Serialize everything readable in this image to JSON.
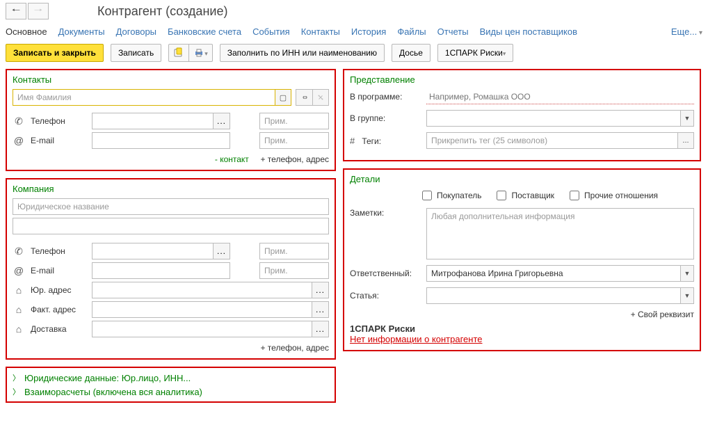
{
  "header": {
    "title": "Контрагент (создание)"
  },
  "tabs": {
    "main": "Основное",
    "docs": "Документы",
    "contracts": "Договоры",
    "bank": "Банковские счета",
    "events": "События",
    "contacts": "Контакты",
    "history": "История",
    "files": "Файлы",
    "reports": "Отчеты",
    "pricetypes": "Виды цен поставщиков",
    "more": "Еще..."
  },
  "toolbar": {
    "save_close": "Записать и закрыть",
    "save": "Записать",
    "fill_inn": "Заполнить по ИНН или наименованию",
    "dossier": "Досье",
    "spark": "1СПАРК Риски"
  },
  "contacts": {
    "title": "Контакты",
    "name_ph": "Имя Фамилия",
    "phone_label": "Телефон",
    "email_label": "E-mail",
    "note_ph": "Прим.",
    "minus_contact": "- контакт",
    "plus_phone": "+ телефон, адрес"
  },
  "company": {
    "title": "Компания",
    "legal_ph": "Юридическое название",
    "phone_label": "Телефон",
    "email_label": "E-mail",
    "legal_addr": "Юр. адрес",
    "actual_addr": "Факт. адрес",
    "delivery": "Доставка",
    "note_ph": "Прим.",
    "plus_phone": "+ телефон, адрес"
  },
  "expanders": {
    "legal": "Юридические данные: Юр.лицо, ИНН...",
    "mutual": "Взаиморасчеты (включена вся аналитика)"
  },
  "presentation": {
    "title": "Представление",
    "in_prog": "В программе:",
    "in_prog_ph": "Например, Ромашка ООО",
    "in_group": "В группе:",
    "tags": "Теги:",
    "tags_ph": "Прикрепить тег (25 символов)"
  },
  "details": {
    "title": "Детали",
    "buyer": "Покупатель",
    "supplier": "Поставщик",
    "other": "Прочие отношения",
    "notes": "Заметки:",
    "notes_ph": "Любая дополнительная информация",
    "responsible": "Ответственный:",
    "responsible_val": "Митрофанова Ирина Григорьевна",
    "article": "Статья:",
    "own_prop": "+ Свой реквизит",
    "spark_title": "1СПАРК Риски",
    "spark_warn": "Нет информации о контрагенте"
  }
}
